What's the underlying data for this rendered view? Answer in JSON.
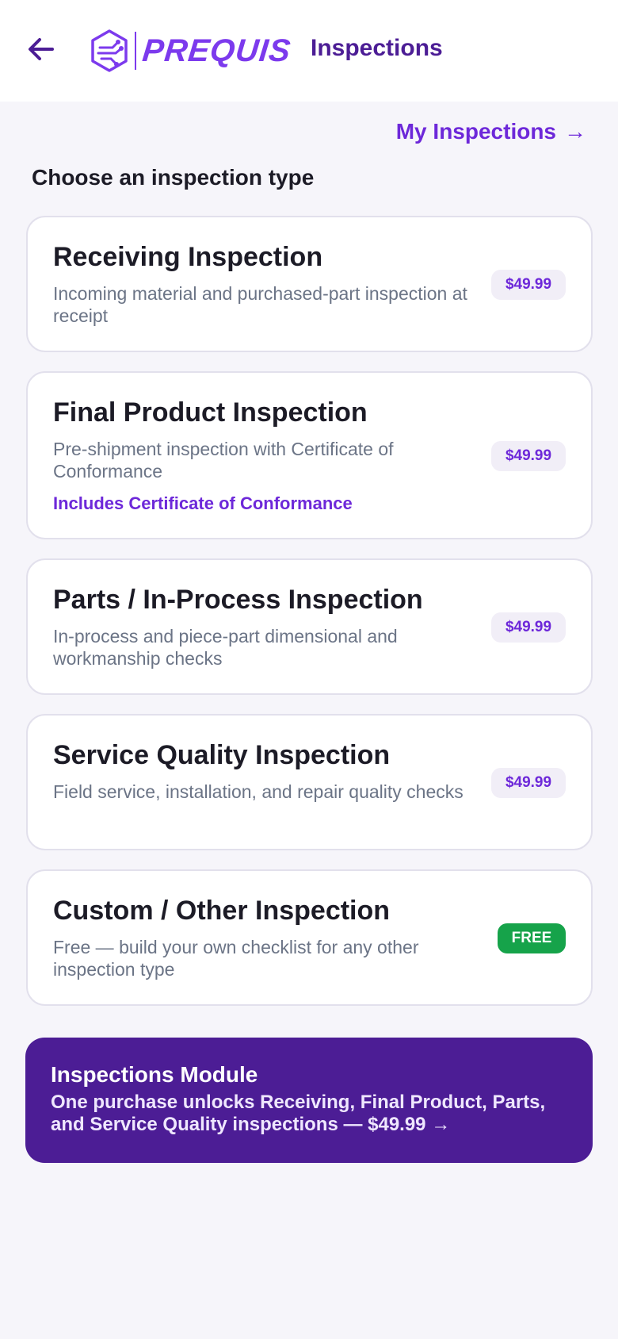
{
  "header": {
    "logo_text": "PREQUIS",
    "title": "Inspections",
    "back_icon": "arrow-left-icon",
    "logo_icon": "shield-circuit-icon"
  },
  "my_inspections": {
    "label": "My Inspections",
    "arrow": "→"
  },
  "section_title": "Choose an inspection type",
  "inspection_types": [
    {
      "title": "Receiving Inspection",
      "description": "Incoming material and purchased-part inspection at receipt",
      "price": "$49.99"
    },
    {
      "title": "Final Product Inspection",
      "description": "Pre-shipment inspection with Certificate of Conformance",
      "extra": "Includes Certificate of Conformance",
      "price": "$49.99"
    },
    {
      "title": "Parts / In-Process Inspection",
      "description": "In-process and piece-part dimensional and workmanship checks",
      "price": "$49.99"
    },
    {
      "title": "Service Quality Inspection",
      "description": "Field service, installation, and repair quality checks",
      "price": "$49.99"
    },
    {
      "title": "Custom / Other Inspection",
      "description": "Free — build your own checklist for any other inspection type",
      "price": "FREE"
    }
  ],
  "module_banner": {
    "title": "Inspections Module",
    "description": "One purchase unlocks Receiving, Final Product, Parts, and Service Quality inspections — $49.99 →"
  },
  "colors": {
    "brand_purple": "#6d28d9",
    "banner_purple": "#4c1d95",
    "free_green": "#16a34a",
    "background": "#f6f5fa"
  }
}
